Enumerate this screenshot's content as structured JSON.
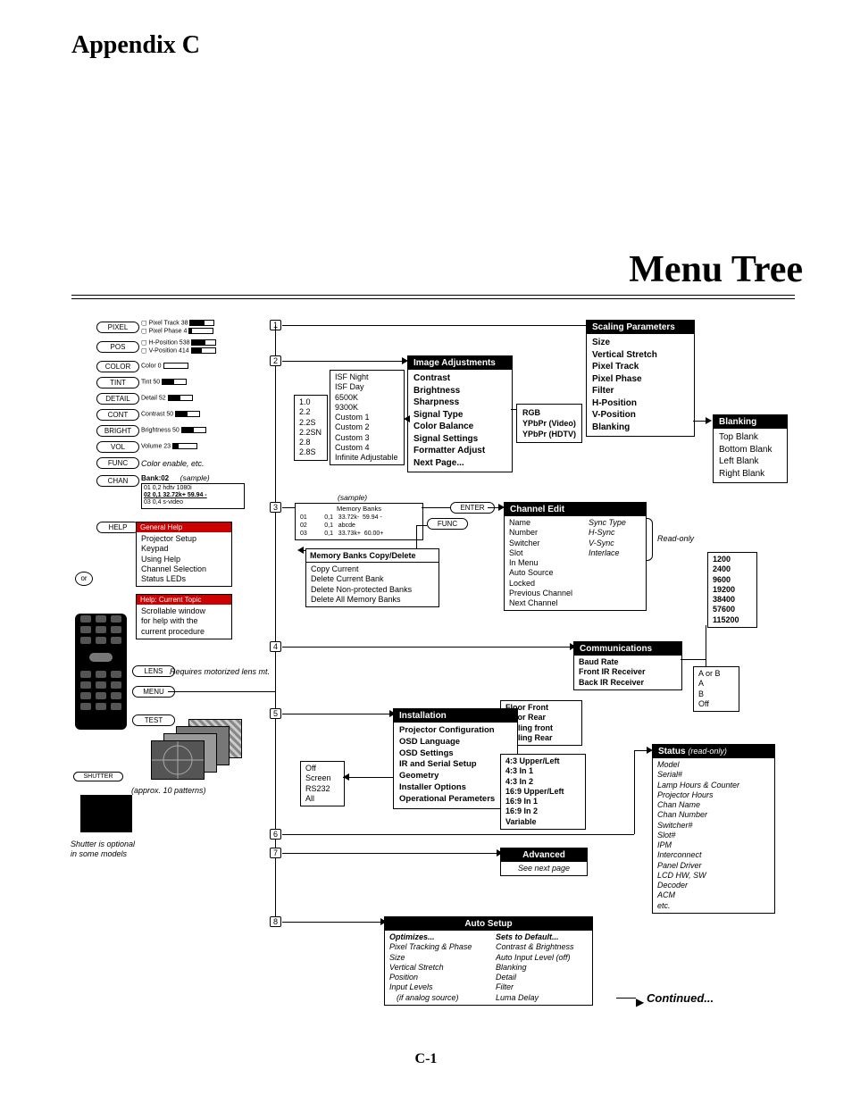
{
  "page": {
    "appendix": "Appendix C",
    "title": "Menu Tree",
    "footer": "C-1",
    "continued": "Continued..."
  },
  "keys": {
    "pixel": "PIXEL",
    "pos": "POS",
    "color": "COLOR",
    "tint": "TINT",
    "detail": "DETAIL",
    "cont": "CONT",
    "bright": "BRIGHT",
    "vol": "VOL",
    "func": "FUNC",
    "chan": "CHAN",
    "help": "HELP",
    "lens": "LENS",
    "menu": "MENU",
    "test": "TEST",
    "shutter": "SHUTTER",
    "enter": "ENTER",
    "or": "or"
  },
  "readouts": {
    "pixel_track": "Pixel Track  38",
    "pixel_phase": "Pixel Phase  4",
    "hpos": "H-Position 538",
    "vpos": "V-Position 414",
    "color": "Color  0",
    "tint": "Tint   50",
    "detail": "Detail 52",
    "contrast": "Contrast 50",
    "brightness": "Brightness 50",
    "volume": "Volume 23",
    "func_note": "Color enable, etc.",
    "bank_label": "Bank:02",
    "sample": "(sample)",
    "chan_l1": "01  0,2  hdtv 1080i",
    "chan_l2": "02  0,1  32.72k+  59.94 -",
    "chan_l3": "03  0,4  s-video",
    "lens_note": "Requires motorized lens mt.",
    "test_note": "(approx. 10 patterns)",
    "shutter_note1": "Shutter is optional",
    "shutter_note2": "in some models",
    "mem_sample": "(sample)",
    "mem_title": "Memory Banks",
    "mem_l1": "01          0,1   33.72k-  59.94 -",
    "mem_l2": "02          0,1   abcde",
    "mem_l3": "03          0,1   33.73k+  60.00+",
    "func2": "FUNC"
  },
  "help": {
    "h1": "General Help",
    "i1": "Projector Setup",
    "i2": "Keypad",
    "i3": "Using Help",
    "i4": "Channel Selection",
    "i5": "Status LEDs",
    "h2": "Help: Current Topic",
    "n1": "Scrollable window",
    "n2": "for help with the",
    "n3": "current procedure"
  },
  "gamma": {
    "i1": "1.0",
    "i2": "2.2",
    "i3": "2.2S",
    "i4": "2.2SN",
    "i5": "2.8",
    "i6": "2.8S"
  },
  "isf": {
    "i1": "ISF Night",
    "i2": "ISF Day",
    "i3": "6500K",
    "i4": "9300K",
    "i5": "Custom 1",
    "i6": "Custom 2",
    "i7": "Custom 3",
    "i8": "Custom 4",
    "i9": "Infinite Adjustable"
  },
  "imgadj": {
    "title": "Image Adjustments",
    "i1": "Contrast",
    "i2": "Brightness",
    "i3": "Sharpness",
    "i4": "Signal Type",
    "i5": "Color Balance",
    "i6": "Signal Settings",
    "i7": "Formatter Adjust",
    "i8": "Next Page..."
  },
  "sigtype": {
    "i1": "RGB",
    "i2": "YPbPr (Video)",
    "i3": "YPbPr (HDTV)"
  },
  "scaling": {
    "title": "Scaling Parameters",
    "i1": "Size",
    "i2": "Vertical Stretch",
    "i3": "Pixel Track",
    "i4": "Pixel Phase",
    "i5": "Filter",
    "i6": "H-Position",
    "i7": "V-Position",
    "i8": "Blanking"
  },
  "blanking": {
    "title": "Blanking",
    "i1": "Top Blank",
    "i2": "Bottom Blank",
    "i3": "Left Blank",
    "i4": "Right Blank"
  },
  "membanks": {
    "title": "Memory Banks Copy/Delete",
    "i1": "Copy Current",
    "i2": "Delete Current Bank",
    "i3": "Delete Non-protected Banks",
    "i4": "Delete All Memory Banks"
  },
  "chedit": {
    "title": "Channel Edit",
    "l1": "Name",
    "l2": "Number",
    "l3": "Switcher",
    "l4": "Slot",
    "l5": "In Menu",
    "l6": "Auto Source",
    "l7": "Locked",
    "l8": "Previous Channel",
    "l9": "Next Channel",
    "r1": "Sync Type",
    "r2": "H-Sync",
    "r3": "V-Sync",
    "r4": "Interlace",
    "ro": "Read-only"
  },
  "baud": {
    "i1": "1200",
    "i2": "2400",
    "i3": "9600",
    "i4": "19200",
    "i5": "38400",
    "i6": "57600",
    "i7": "115200"
  },
  "comms": {
    "title": "Communications",
    "i1": "Baud Rate",
    "i2": "Front IR Receiver",
    "i3": "Back IR Receiver"
  },
  "irsel": {
    "i1": "A or B",
    "i2": "A",
    "i3": "B",
    "i4": "Off"
  },
  "projcfg": {
    "i1": "Floor Front",
    "i2": "Floor Rear",
    "i3": "Ceiling front",
    "i4": "Ceiling Rear"
  },
  "install": {
    "title": "Installation",
    "i1": "Projector Configuration",
    "i2": "OSD Language",
    "i3": "OSD Settings",
    "i4": "IR and Serial Setup",
    "i5": "Geometry",
    "i6": "Installer Options",
    "i7": "Operational Perameters"
  },
  "geom": {
    "i1": "Off",
    "i2": "Screen",
    "i3": "RS232",
    "i4": "All"
  },
  "aspect": {
    "i1": "4:3 Upper/Left",
    "i2": "4:3 In 1",
    "i3": "4:3 In 2",
    "i4": "16:9 Upper/Left",
    "i5": "16:9 In 1",
    "i6": "16:9 In 2",
    "i7": "Variable"
  },
  "adv": {
    "title": "Advanced",
    "note": "See next page"
  },
  "autosetup": {
    "title": "Auto Setup",
    "lh": "Optimizes...",
    "l1": "Pixel Tracking & Phase",
    "l2": "Size",
    "l3": "Vertical Stretch",
    "l4": "Position",
    "l5": "Input Levels",
    "l6": "(if analog source)",
    "rh": "Sets to Default...",
    "r1": "Contrast & Brightness",
    "r2": "Auto Input Level (off)",
    "r3": "Blanking",
    "r4": "Detail",
    "r5": "Filter",
    "r6": "Luma Delay"
  },
  "status": {
    "title": "Status",
    "ro": "(read-only)",
    "i1": "Model",
    "i2": "Serial#",
    "i3": "Lamp Hours & Counter",
    "i4": "Projector Hours",
    "i5": "Chan Name",
    "i6": "Chan Number",
    "i7": "Switcher#",
    "i8": "Slot#",
    "i9": "IPM",
    "i10": "Interconnect",
    "i11": "Panel Driver",
    "i12": "LCD HW, SW",
    "i13": "Decoder",
    "i14": "ACM",
    "i15": "etc."
  },
  "nums": {
    "n1": "1",
    "n2": "2",
    "n3": "3",
    "n4": "4",
    "n5": "5",
    "n6": "6",
    "n7": "7",
    "n8": "8"
  }
}
